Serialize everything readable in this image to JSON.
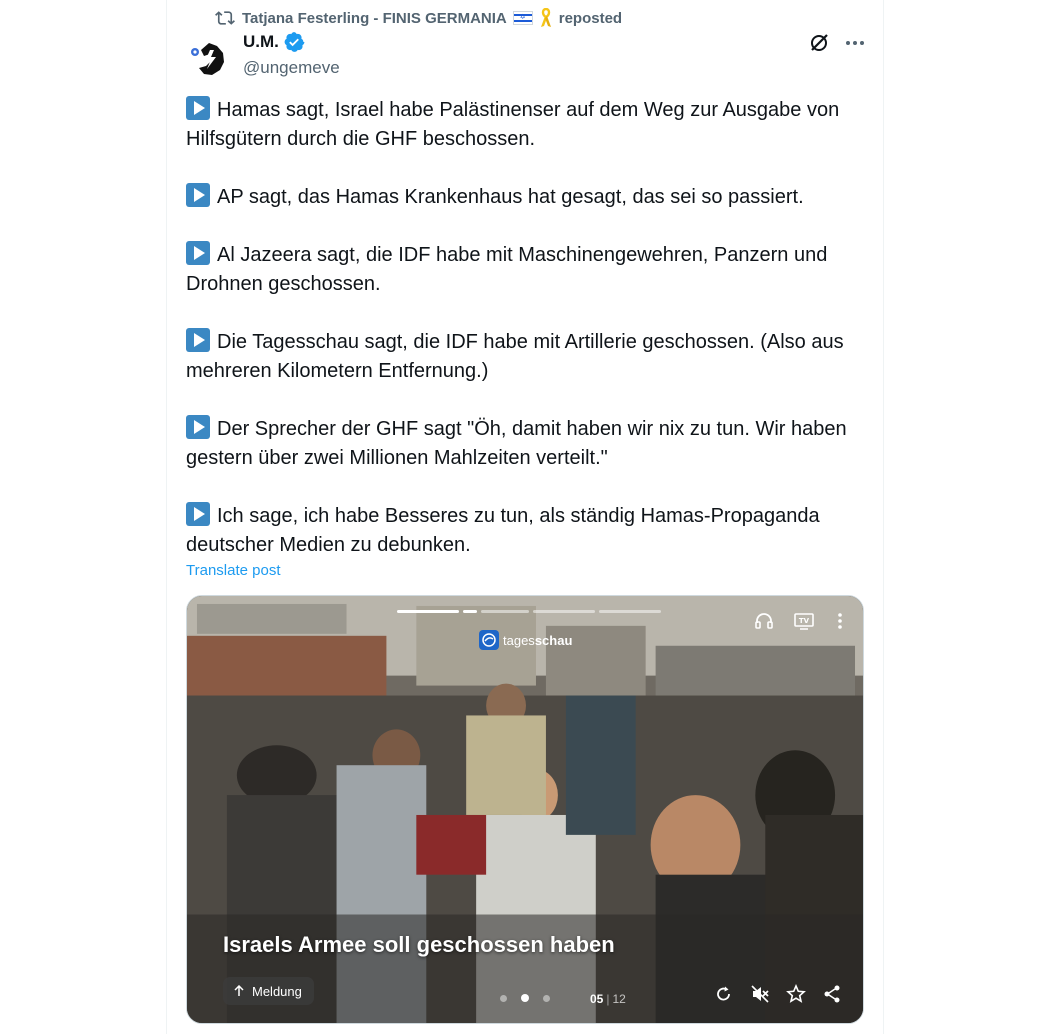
{
  "repost": {
    "reposter_name": "Tatjana Festerling - FINIS GERMANIA",
    "reposted_label": "reposted",
    "icons": [
      "repost-icon",
      "israel-flag-icon",
      "yellow-ribbon-icon"
    ]
  },
  "author": {
    "display_name": "U.M.",
    "handle": "@ungemeve",
    "verified": true
  },
  "post": {
    "paragraphs": [
      "Hamas sagt, Israel habe Palästinenser auf dem Weg zur Ausgabe von Hilfsgütern durch die GHF beschossen.",
      "AP sagt, das Hamas Krankenhaus hat gesagt, das sei so passiert.",
      "Al Jazeera sagt, die IDF habe mit Maschinengewehren, Panzern und Drohnen geschossen.",
      "Die Tagesschau sagt, die IDF habe mit Artillerie geschossen. (Also aus mehreren Kilometern Entfernung.)",
      "Der Sprecher der GHF sagt \"Öh, damit haben wir nix zu tun. Wir haben gestern über zwei Millionen Mahlzeiten verteilt.\"",
      "Ich sage, ich habe Besseres zu tun, als ständig Hamas-Propaganda deutscher Medien zu debunken."
    ],
    "bullet_icon": "play-button-icon",
    "translate_label": "Translate post"
  },
  "media": {
    "brand_prefix": "tages",
    "brand_suffix": "schau",
    "caption": "Israels Armee soll geschossen haben",
    "meldung_label": "Meldung",
    "counter_current": "05",
    "counter_total": "12",
    "story_segments": 4,
    "active_segment": 1,
    "carousel_dots": 3,
    "active_dot": 1
  },
  "colors": {
    "accent": "#1d9bf0",
    "secondary_text": "#536471",
    "play_badge": "#3b88c3",
    "brand_blue": "#1e66c8"
  }
}
